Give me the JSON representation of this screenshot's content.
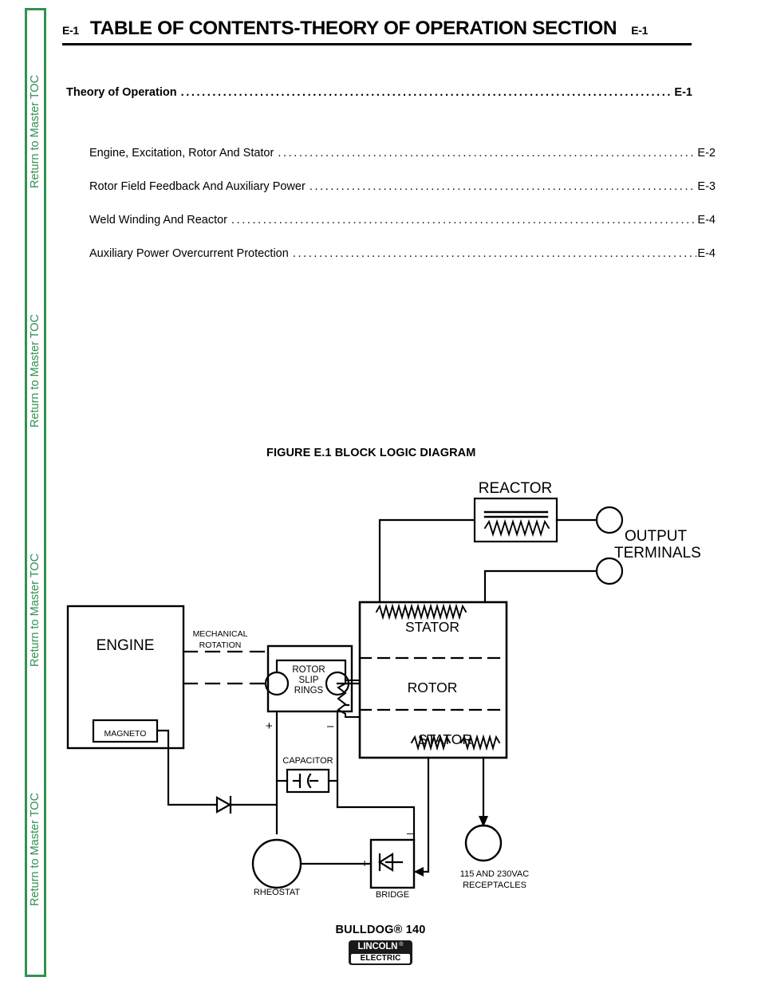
{
  "sidebar": {
    "links": [
      {
        "label": "Return to Master TOC"
      },
      {
        "label": "Return to Master TOC"
      },
      {
        "label": "Return to Master TOC"
      },
      {
        "label": "Return to Master TOC"
      }
    ],
    "color": "#33914f"
  },
  "header": {
    "page_code_left": "E-1",
    "title": "TABLE OF CONTENTS-THEORY OF OPERATION SECTION",
    "page_code_right": "E-1"
  },
  "toc": {
    "leader": "............................................................................................................",
    "entries": [
      {
        "label": "Theory of Operation",
        "page": "E-1",
        "level": "main"
      },
      {
        "label": "Engine, Excitation, Rotor And Stator",
        "page": "E-2",
        "level": "sub"
      },
      {
        "label": "Rotor Field Feedback And Auxiliary Power",
        "page": "E-3",
        "level": "sub"
      },
      {
        "label": "Weld Winding And Reactor",
        "page": "E-4",
        "level": "sub"
      },
      {
        "label": "Auxiliary Power Overcurrent Protection",
        "page": "E-4",
        "level": "sub"
      }
    ]
  },
  "figure": {
    "caption": "FIGURE E.1  BLOCK LOGIC DIAGRAM",
    "labels": {
      "reactor": "REACTOR",
      "output_terminals_line1": "OUTPUT",
      "output_terminals_line2": "TERMINALS",
      "stator_top": "STATOR",
      "rotor": "ROTOR",
      "stator_bottom": "STATOR",
      "engine": "ENGINE",
      "magneto": "MAGNETO",
      "mechanical_line1": "MECHANICAL",
      "mechanical_line2": "ROTATION",
      "slip_rings_line1": "ROTOR",
      "slip_rings_line2": "SLIP",
      "slip_rings_line3": "RINGS",
      "plus_left": "+",
      "minus_right": "–",
      "capacitor": "CAPACITOR",
      "rheostat": "RHEOSTAT",
      "bridge": "BRIDGE",
      "bridge_plus": "+",
      "bridge_minus": "–",
      "receptacles_line1": "115 AND 230VAC",
      "receptacles_line2": "RECEPTACLES"
    }
  },
  "footer": {
    "model": "BULLDOG® 140",
    "logo_word": "LINCOLN",
    "logo_reg": "®",
    "logo_word2": "ELECTRIC"
  }
}
